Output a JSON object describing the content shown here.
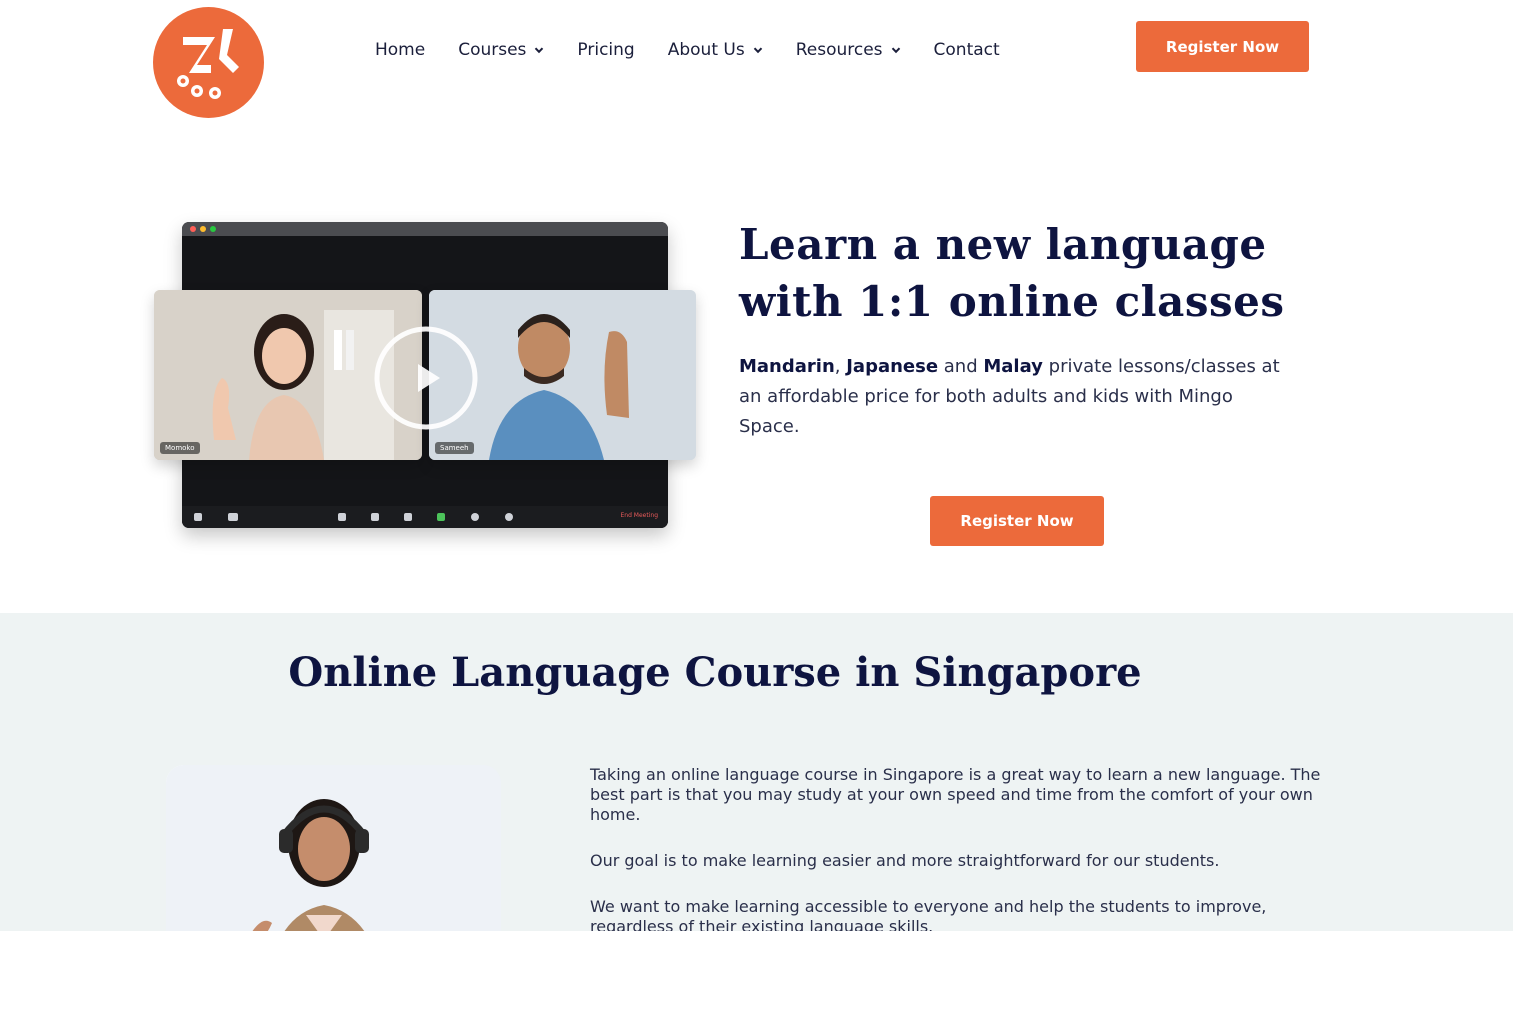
{
  "brand": {
    "accent": "#ec6a3b",
    "heading": "#0e1440",
    "section_bg": "#eef3f3"
  },
  "header": {
    "logo_icon": "mingo-space-logo-icon",
    "nav": [
      {
        "label": "Home",
        "dropdown": false
      },
      {
        "label": "Courses",
        "dropdown": true
      },
      {
        "label": "Pricing",
        "dropdown": false
      },
      {
        "label": "About Us",
        "dropdown": true
      },
      {
        "label": "Resources",
        "dropdown": true
      },
      {
        "label": "Contact",
        "dropdown": false
      }
    ],
    "cta_label": "Register Now"
  },
  "hero": {
    "title": "Learn a new language with 1:1 online classes",
    "desc": {
      "lang1": "Mandarin",
      "sep": ", ",
      "lang2": "Japanese",
      "and": " and ",
      "lang3": "Malay",
      "rest": " private lessons/classes at an affordable price for both adults and kids with Mingo Space."
    },
    "cta_label": "Register Now",
    "video": {
      "participant_left": "Momoko",
      "participant_right": "Sameeh",
      "end_label": "End Meeting"
    }
  },
  "section": {
    "title": "Online Language Course in Singapore",
    "paragraphs": [
      "Taking an online language course in Singapore is a great way to learn a new language. The best part is that you may study at your own speed and time from the comfort of your own home.",
      "Our goal is to make learning easier and more straightforward for our students.",
      "We want to make learning accessible to everyone and help the students to improve, regardless of their existing language skills."
    ]
  }
}
